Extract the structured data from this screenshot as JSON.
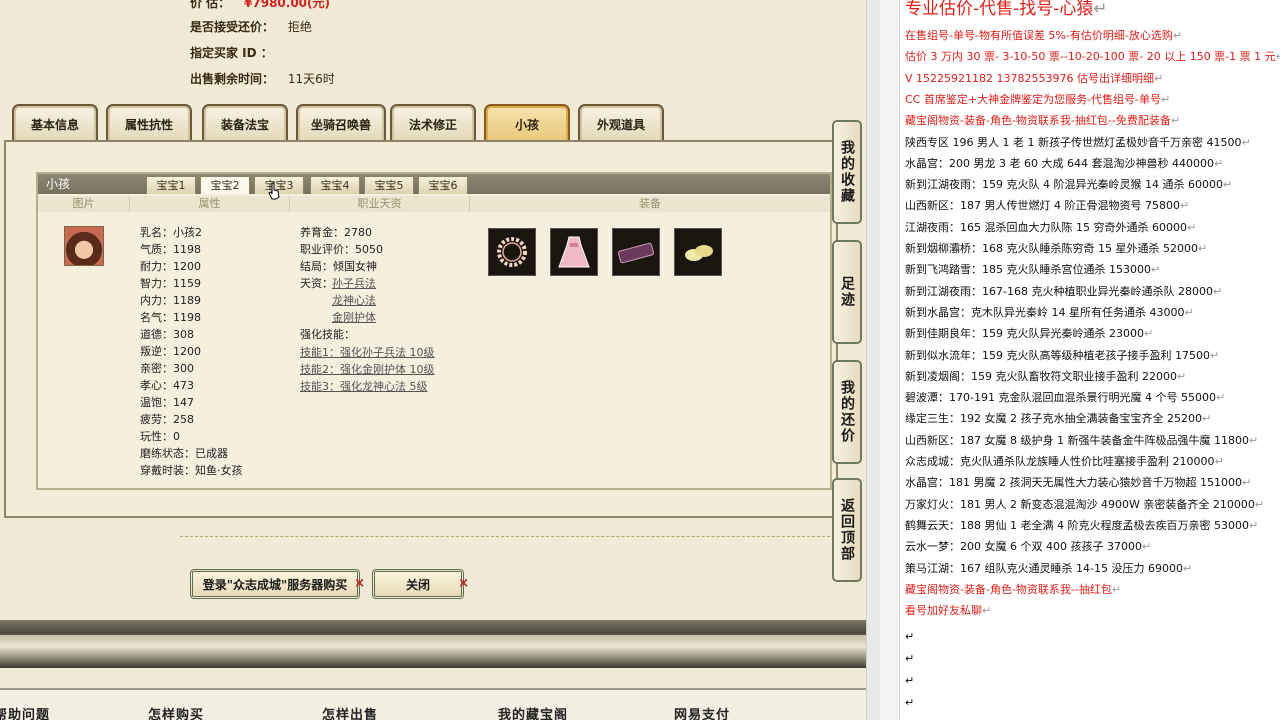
{
  "listing": {
    "price_label": "价      估：",
    "price_value": "¥7980.00(元)",
    "bargain_label": "是否接受还价：",
    "bargain_value": "拒绝",
    "buyer_label": "指定买家 ID ：",
    "buyer_value": "",
    "time_label": "出售剩余时间：",
    "time_value": "11天6时"
  },
  "main_tabs": [
    "基本信息",
    "属性抗性",
    "装备法宝",
    "坐骑召唤兽",
    "法术修正",
    "小孩",
    "外观道具"
  ],
  "main_tab_active": "小孩",
  "child_panel": {
    "title": "小孩",
    "sub_tabs": [
      "宝宝1",
      "宝宝2",
      "宝宝3",
      "宝宝4",
      "宝宝5",
      "宝宝6"
    ],
    "sub_tab_active": "宝宝2",
    "columns": [
      "图片",
      "属性",
      "职业天资",
      "装备"
    ],
    "attributes": [
      "乳名：小孩2",
      "气质：1198",
      "耐力：1200",
      "智力：1159",
      "内力：1189",
      "名气：1198",
      "道德：308",
      "叛逆：1200",
      "亲密：300",
      "孝心：473",
      "温饱：147",
      "疲劳：258",
      "玩性：0",
      "磨练状态：已成器",
      "穿戴时装：知鱼·女孩"
    ],
    "career": {
      "raise_gold": "养育金：2780",
      "career_rating": "职业评价：5050",
      "ending": "结局：倾国女神",
      "talent_label": "天资：",
      "talents": [
        "孙子兵法",
        "龙神心法",
        "金刚护体"
      ],
      "skills_label": "强化技能：",
      "skills": [
        "技能1：强化孙子兵法 10级",
        "技能2：强化金刚护体 10级",
        "技能3：强化龙神心法 5级"
      ]
    },
    "equipment_icons": [
      "flower-wreath-icon",
      "pink-dress-icon",
      "purple-scroll-icon",
      "shoes-icon"
    ]
  },
  "buttons": {
    "login_label": "登录\"众志成城\"服务器购买",
    "close_label": "关闭",
    "x_mark": "×"
  },
  "side_buttons": [
    "我的收藏",
    "足迹",
    "我的还价",
    "返回顶部"
  ],
  "footer": [
    "帮助问题",
    "怎样购买",
    "怎样出售",
    "我的藏宝阁",
    "网易支付"
  ],
  "document": {
    "heading": "专业估价-代售-找号-心猿",
    "pilcrow": "↵",
    "lines": [
      {
        "t": "在售组号-单号-物有所值误差 5%-有估价明细-放心选购",
        "red": true
      },
      {
        "t": "估价 3 万内 30 票- 3-10-50 票--10-20-100 票- 20 以上 150 票-1 票 1 元",
        "red": true
      },
      {
        "t": "V 15225921182    13782553976    估号出详细明细",
        "red": true
      },
      {
        "t": "CC 首席鉴定+大神金牌鉴定为您服务-代售组号-单号",
        "red": true
      },
      {
        "t": "藏宝阁物资-装备-角色-物资联系我-抽红包--免费配装备",
        "red": true
      },
      {
        "t": "陕西专区 196 男人 1 老 1 新孩子传世燃灯孟极妙音千万亲密 41500",
        "red": false
      },
      {
        "t": "水晶宫：200 男龙 3 老 60 大成 644 套混淘沙神兽秒 440000",
        "red": false
      },
      {
        "t": "新到江湖夜雨：159 克火队 4 阶混异光秦岭灵猴 14 通杀 60000",
        "red": false
      },
      {
        "t": "山西新区：187 男人传世燃灯 4 阶正骨混物资号 75800",
        "red": false
      },
      {
        "t": "江湖夜雨：165 混杀回血大力队陈 15 穷奇外通杀 60000",
        "red": false
      },
      {
        "t": "新到烟柳灞桥：168 克火队睡杀陈穷奇 15 星外通杀 52000",
        "red": false
      },
      {
        "t": "新到飞鸿踏雪：185 克火队睡杀宫位通杀 153000",
        "red": false
      },
      {
        "t": "新到江湖夜雨：167-168 克火种植职业异光秦岭通杀队 28000",
        "red": false
      },
      {
        "t": "新到水晶宫：克木队异光秦岭 14 星所有任务通杀 43000",
        "red": false
      },
      {
        "t": "新到佳期良年：159 克火队异光秦岭通杀 23000",
        "red": false
      },
      {
        "t": "新到似水流年：159 克火队高等级种植老孩子接手盈利 17500",
        "red": false
      },
      {
        "t": "新到凌烟阁：159 克火队畜牧符文职业接手盈利 22000",
        "red": false
      },
      {
        "t": "碧波潭：170-191 克金队混回血混杀景行明光魔 4 个号 55000",
        "red": false
      },
      {
        "t": "缘定三生：192 女魔 2 孩子克水抽全满装备宝宝齐全 25200",
        "red": false
      },
      {
        "t": "山西新区：187 女魔 8 级护身 1 新强牛装备金牛阵极品强牛魔 11800",
        "red": false
      },
      {
        "t": "众志成城：克火队通杀队龙族睡人性价比哇塞接手盈利 210000",
        "red": false
      },
      {
        "t": "水晶宫：181 男魔 2 孩洞天无属性大力装心猿妙音千万物超 151000",
        "red": false
      },
      {
        "t": "万家灯火：181 男人 2 新变态混混淘沙 4900W 亲密装备齐全 210000",
        "red": false
      },
      {
        "t": "鹤舞云天：188 男仙 1 老全满 4 阶克火程度孟极去疾百万亲密 53000",
        "red": false
      },
      {
        "t": "云水一梦：200 女魔 6 个双 400 孩孩子 37000",
        "red": false
      },
      {
        "t": "策马江湖：167 组队克火通灵睡杀 14-15 没压力 69000",
        "red": false
      },
      {
        "t": "藏宝阁物资-装备-角色-物资联系我--抽红包",
        "red": true
      },
      {
        "t": "看号加好友私聊",
        "red": true
      }
    ]
  },
  "colors": {
    "accent_red": "#e0201a",
    "panel_bg": "#f3ecd8",
    "active_tab": "#e9c879"
  }
}
